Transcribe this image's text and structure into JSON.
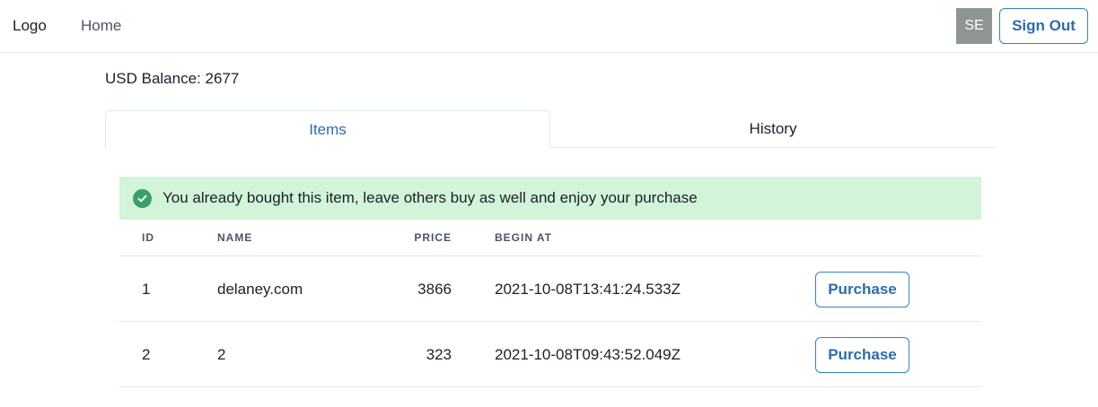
{
  "nav": {
    "logo": "Logo",
    "home": "Home",
    "avatar_initials": "SE",
    "sign_out": "Sign Out"
  },
  "balance": {
    "label": "USD Balance:",
    "value": "2677"
  },
  "tabs": [
    {
      "label": "Items",
      "active": true
    },
    {
      "label": "History",
      "active": false
    }
  ],
  "alert": {
    "icon": "check-circle-icon",
    "message": "You already bought this item, leave others buy as well and enjoy your purchase"
  },
  "table": {
    "headers": [
      "ID",
      "NAME",
      "PRICE",
      "BEGIN AT"
    ],
    "rows": [
      {
        "id": "1",
        "name": "delaney.com",
        "price": "3866",
        "begin_at": "2021-10-08T13:41:24.533Z",
        "action": "Purchase"
      },
      {
        "id": "2",
        "name": "2",
        "price": "323",
        "begin_at": "2021-10-08T09:43:52.049Z",
        "action": "Purchase"
      }
    ]
  },
  "colors": {
    "accent": "#2b6cb0",
    "alert_bg": "#d2f4d8",
    "success_icon": "#38a169",
    "avatar_bg": "#8e9694"
  }
}
